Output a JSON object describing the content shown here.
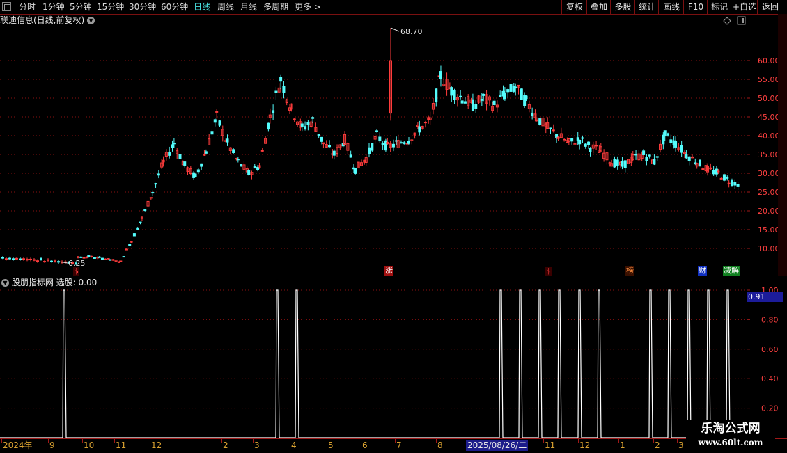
{
  "toolbar": {
    "periods": [
      {
        "label": "分时",
        "active": false
      },
      {
        "label": "1分钟",
        "active": false
      },
      {
        "label": "5分钟",
        "active": false
      },
      {
        "label": "15分钟",
        "active": false
      },
      {
        "label": "30分钟",
        "active": false
      },
      {
        "label": "60分钟",
        "active": false
      },
      {
        "label": "日线",
        "active": true
      },
      {
        "label": "周线",
        "active": false
      },
      {
        "label": "月线",
        "active": false
      },
      {
        "label": "多周期",
        "active": false
      },
      {
        "label": "更多",
        "active": false
      }
    ],
    "right_buttons": [
      "复权",
      "叠加",
      "多股",
      "统计",
      "画线",
      "F10",
      "标记",
      "+自选",
      "返回"
    ]
  },
  "chart_title": "联迪信息(日线,前复权)",
  "price_axis": {
    "ticks": [
      "60.00",
      "55.00",
      "50.00",
      "45.00",
      "40.00",
      "35.00",
      "30.00",
      "25.00",
      "20.00",
      "15.00",
      "10.00"
    ]
  },
  "annotations": {
    "high": "68.70",
    "low": "6.25"
  },
  "flags": [
    {
      "label": "$",
      "color": "#ff4040",
      "bg": "#3a0000"
    },
    {
      "label": "涨",
      "color": "#ffffff",
      "bg": "#a01010"
    },
    {
      "label": "$",
      "color": "#ff4040",
      "bg": "#3a0000"
    },
    {
      "label": "榜",
      "color": "#ff9040",
      "bg": "#3a1000"
    },
    {
      "label": "财",
      "color": "#ffffff",
      "bg": "#1030c0"
    },
    {
      "label": "减解",
      "color": "#ffffff",
      "bg": "#108020"
    }
  ],
  "indicator": {
    "name": "股朋指标网",
    "label": "选股: 0.00",
    "current_value": "0.91",
    "ticks": [
      "1.00",
      "0.80",
      "0.60",
      "0.40",
      "0.20"
    ]
  },
  "date_axis": {
    "labels": [
      "2024年",
      "9",
      "10",
      "11",
      "12",
      "2",
      "3",
      "4",
      "5",
      "6",
      "7",
      "8",
      "11",
      "12",
      "1",
      "2",
      "3"
    ],
    "highlight": "2025/08/26/二"
  },
  "watermark": {
    "line1": "乐淘公式网",
    "line2": "www.60lt.com"
  },
  "colors": {
    "up": "#ff3c3c",
    "down": "#54fcfc",
    "grid": "#8a1010",
    "signal": "#ffffff"
  },
  "chart_data": [
    {
      "type": "candlestick",
      "title": "联迪信息(日线,前复权)",
      "ylim": [
        6.25,
        68.7
      ],
      "x_categories": [
        "2024年",
        "9",
        "10",
        "11",
        "12",
        "2",
        "3",
        "4",
        "5",
        "6",
        "7",
        "8",
        "2025/08/26",
        "11",
        "12",
        "1",
        "2",
        "3"
      ],
      "series": [
        {
          "name": "close",
          "values": [
            7.6,
            7.8,
            7.5,
            7.0,
            6.5,
            12,
            18,
            25,
            33,
            38,
            32,
            29,
            36,
            45,
            38,
            33,
            30,
            32,
            45,
            55,
            47,
            42,
            44,
            38,
            35,
            39,
            31,
            34,
            40,
            37,
            38,
            39,
            42,
            44,
            56,
            52,
            50,
            48,
            50,
            48,
            51,
            53,
            49,
            45,
            42,
            40,
            38,
            39,
            37,
            36,
            33,
            32,
            34,
            35,
            33,
            40,
            38,
            35,
            33,
            31,
            30,
            28,
            27
          ]
        }
      ],
      "annotations": {
        "high": 68.7,
        "low": 6.25
      }
    },
    {
      "type": "line",
      "title": "股朋指标网",
      "ylim": [
        0,
        1
      ],
      "series": [
        {
          "name": "选股",
          "x_index": [
            93,
            399,
            427,
            720,
            748,
            776,
            804,
            833,
            861,
            935,
            962,
            990,
            1018,
            1046
          ],
          "values": [
            1,
            1,
            1,
            1,
            1,
            1,
            1,
            1,
            1,
            1,
            1,
            1,
            1,
            1
          ]
        }
      ]
    }
  ]
}
